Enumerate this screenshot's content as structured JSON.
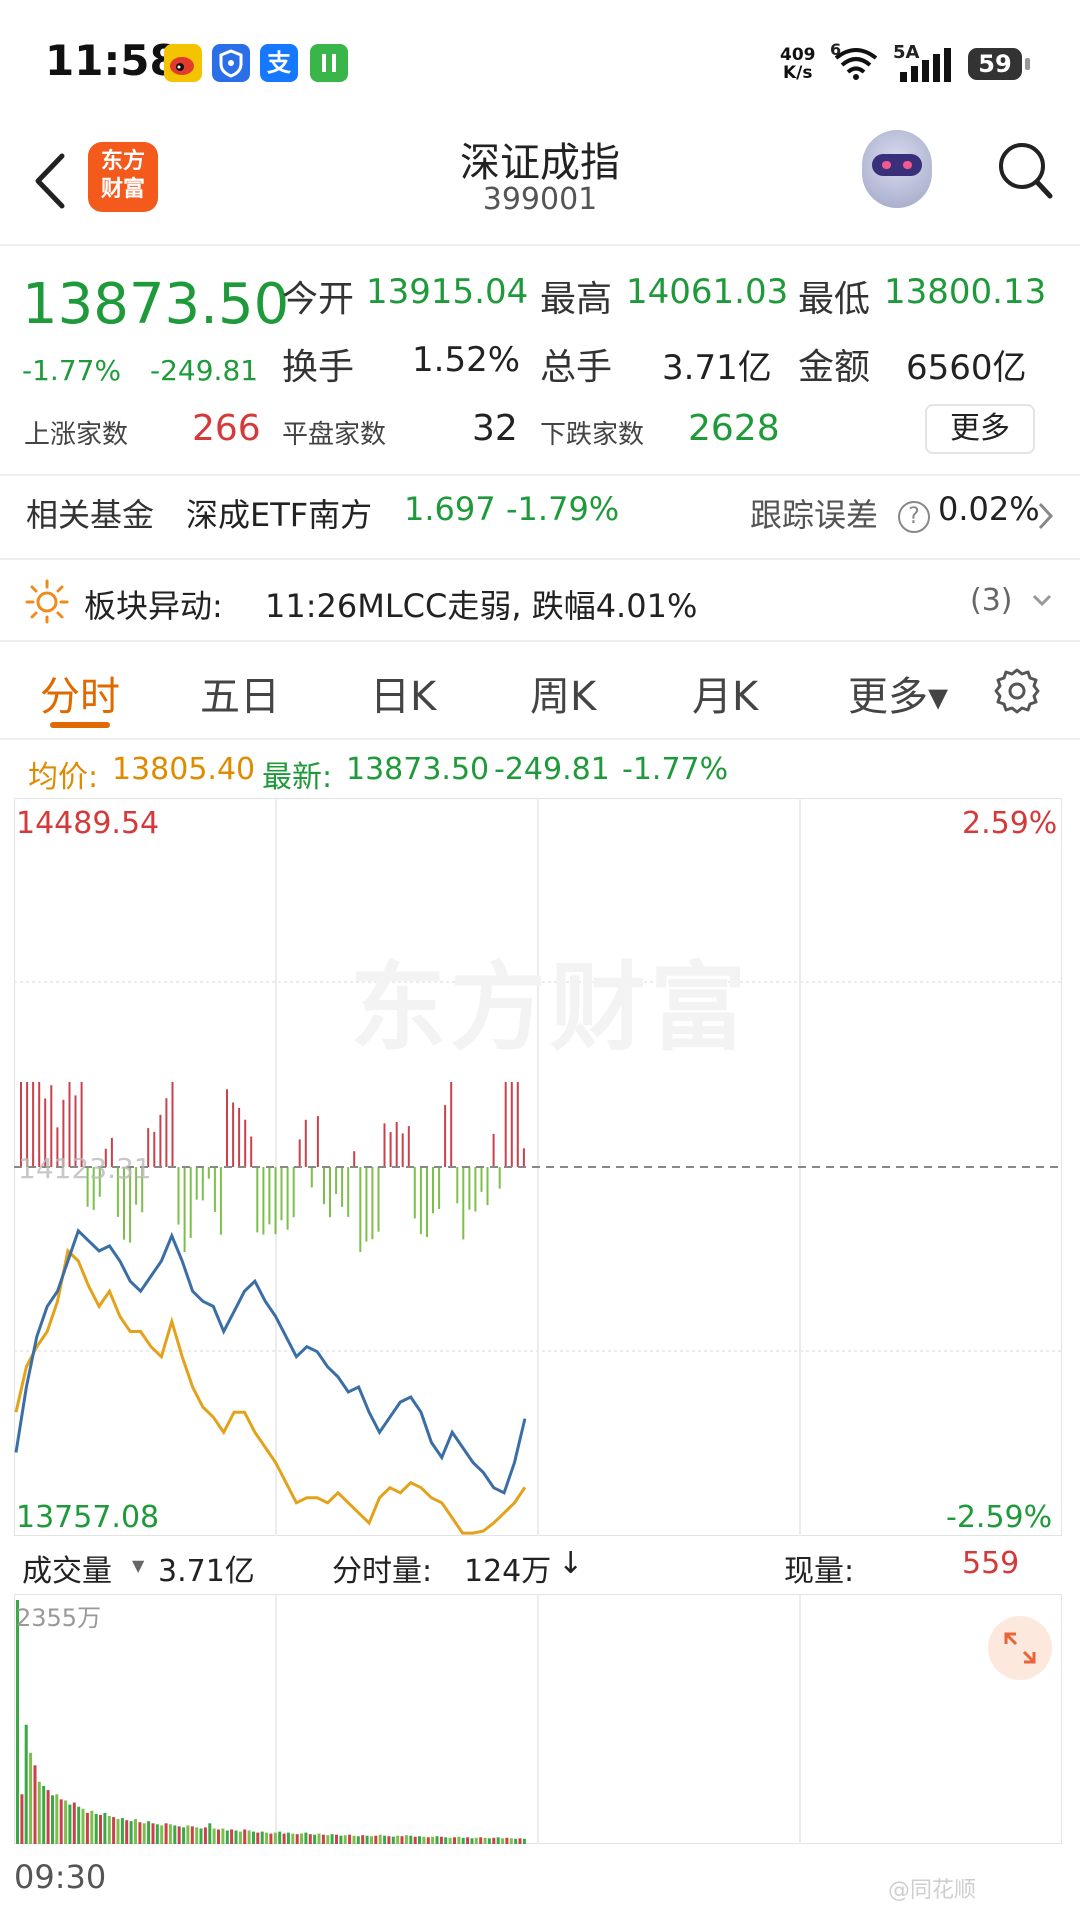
{
  "status_bar": {
    "time": "11:58",
    "network_speed": "409",
    "network_unit": "K/s",
    "wifi_label": "6",
    "signal_label": "5A",
    "battery": "59",
    "apps": [
      "weibo-icon",
      "shield-app-icon",
      "alipay-icon",
      "green-app-icon"
    ],
    "alipay_glyph": "支"
  },
  "header": {
    "logo_line1": "东方",
    "logo_line2": "财富",
    "title": "深证成指",
    "code": "399001"
  },
  "quote": {
    "last_price": "13873.50",
    "change_pct": "-1.77%",
    "change_abs": "-249.81",
    "open_label": "今开",
    "open": "13915.04",
    "high_label": "最高",
    "high": "14061.03",
    "low_label": "最低",
    "low": "13800.13",
    "turnover_label": "换手",
    "turnover": "1.52%",
    "volume_label": "总手",
    "volume": "3.71亿",
    "amount_label": "金额",
    "amount": "6560亿",
    "up_label": "上涨家数",
    "up_count": "266",
    "flat_label": "平盘家数",
    "flat_count": "32",
    "down_label": "下跌家数",
    "down_count": "2628",
    "more_label": "更多"
  },
  "fund": {
    "label": "相关基金",
    "name": "深成ETF南方",
    "price": "1.697",
    "change": "-1.79%",
    "tracking_label": "跟踪误差",
    "tracking_value": "0.02%",
    "help_glyph": "?"
  },
  "alert": {
    "label": "板块异动:",
    "text": "11:26MLCC走弱, 跌幅4.01%",
    "count": "(3)"
  },
  "tabs": [
    "分时",
    "五日",
    "日K",
    "周K",
    "月K",
    "更多▾"
  ],
  "legend": {
    "avg_label": "均价:",
    "avg_value": "13805.40",
    "latest_label": "最新:",
    "latest_value": "13873.50",
    "latest_change": "-249.81",
    "latest_pct": "-1.77%"
  },
  "chart": {
    "y_top": "14489.54",
    "y_bottom": "13757.08",
    "pct_top": "2.59%",
    "pct_bottom": "-2.59%",
    "prev_close": "14123.31",
    "watermark": "东方财富",
    "colors": {
      "price": "#3a6ea5",
      "avg": "#e3a21a",
      "up": "#c9414d",
      "down": "#7cbf4a"
    }
  },
  "volume": {
    "selector_label": "成交量",
    "total": "3.71亿",
    "minute_label": "分时量:",
    "minute_value": "124万",
    "minute_arrow": "↓",
    "current_label": "现量:",
    "current_value": "559",
    "max_label": "2355万",
    "start_time": "09:30"
  },
  "footer": {
    "watermark": "@同花顺"
  },
  "chart_data": {
    "type": "line",
    "ylim": [
      13757.08,
      14489.54
    ],
    "y2lim": [
      -2.59,
      2.59
    ],
    "prev_close": 14123.31,
    "session_minutes": 240,
    "elapsed_minutes": 117,
    "series": [
      {
        "name": "最新",
        "values": [
          13840,
          13905,
          13955,
          13985,
          14000,
          14030,
          14060,
          14050,
          14040,
          14045,
          14030,
          14010,
          14000,
          14015,
          14030,
          14055,
          14030,
          14000,
          13990,
          13985,
          13960,
          13980,
          14000,
          14010,
          13990,
          13975,
          13955,
          13935,
          13945,
          13940,
          13925,
          13915,
          13900,
          13905,
          13880,
          13860,
          13875,
          13890,
          13895,
          13880,
          13850,
          13835,
          13860,
          13845,
          13830,
          13820,
          13805,
          13800,
          13830,
          13873.5
        ]
      },
      {
        "name": "均价",
        "values": [
          13880,
          13925,
          13945,
          13960,
          13990,
          14040,
          14030,
          14005,
          13985,
          14000,
          13975,
          13960,
          13960,
          13945,
          13935,
          13970,
          13935,
          13905,
          13885,
          13875,
          13860,
          13880,
          13880,
          13860,
          13845,
          13830,
          13810,
          13790,
          13795,
          13795,
          13790,
          13800,
          13790,
          13780,
          13770,
          13795,
          13805,
          13800,
          13810,
          13805,
          13795,
          13790,
          13775,
          13760,
          13760,
          13762,
          13770,
          13780,
          13790,
          13805.4
        ]
      }
    ],
    "volume_values": [
      2355,
      480,
      1150,
      880,
      760,
      600,
      560,
      520,
      470,
      480,
      430,
      420,
      380,
      400,
      360,
      340,
      300,
      320,
      290,
      280,
      300,
      270,
      260,
      240,
      250,
      230,
      220,
      240,
      210,
      200,
      220,
      200,
      190,
      180,
      200,
      190,
      180,
      170,
      160,
      180,
      170,
      160,
      150,
      160,
      200,
      150,
      140,
      150,
      130,
      140,
      130,
      120,
      140,
      130,
      120,
      110,
      120,
      110,
      100,
      110,
      120,
      100,
      110,
      100,
      95,
      100,
      110,
      95,
      90,
      100,
      90,
      85,
      95,
      90,
      80,
      85,
      90,
      80,
      75,
      85,
      80,
      75,
      80,
      90,
      80,
      75,
      70,
      80,
      75,
      85,
      80,
      70,
      75,
      70,
      65,
      70,
      75,
      70,
      65,
      60,
      65,
      70,
      60,
      65,
      55,
      60,
      65,
      60,
      55,
      60,
      65,
      55,
      60,
      55,
      50,
      55,
      50
    ],
    "volume_unit": "万",
    "ticks_x": [
      "09:30"
    ]
  }
}
